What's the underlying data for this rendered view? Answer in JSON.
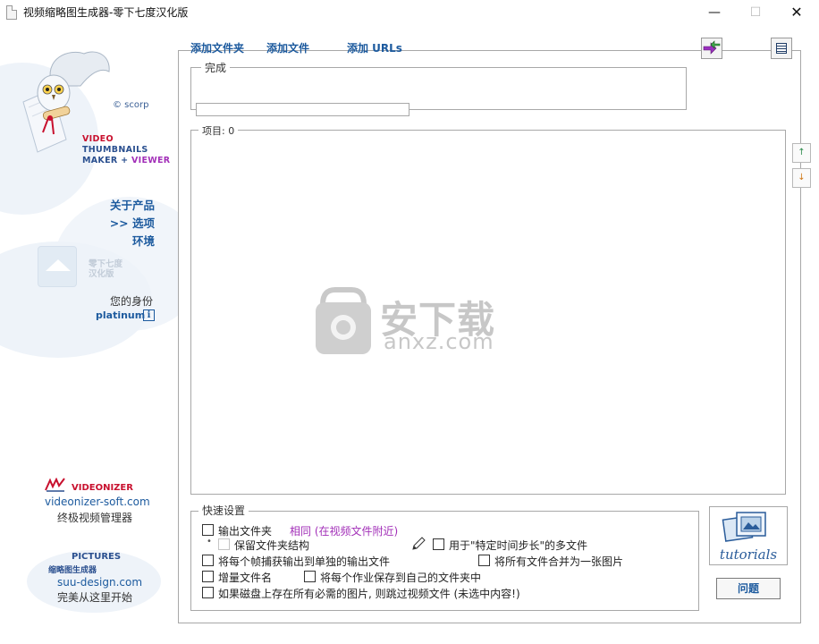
{
  "window": {
    "title": "视频缩略图生成器-零下七度汉化版",
    "minimize_glyph": "—",
    "maximize_glyph": "☐",
    "close_glyph": "✕"
  },
  "sidebar": {
    "copyright": "© scorp",
    "brand": {
      "line1": "VIDEO",
      "line2": "THUMBNAILS",
      "line3_prefix": "MAKER + ",
      "line3_suffix": "VIEWER"
    },
    "nav": {
      "about": "关于产品",
      "options": ">> 选项",
      "environment": "环境"
    },
    "ghost_text": {
      "line1": "零下七度",
      "line2": "汉化版"
    },
    "identity_label": "您的身份",
    "identity_value": "platinum",
    "info_glyph": "i",
    "videonizer": {
      "name": "VIDEONIZER",
      "site": "videonizer-soft.com",
      "desc": "终极视频管理器"
    },
    "pictures": {
      "name": "PICTURES",
      "sub": "缩略图生成器",
      "site": "suu-design.com",
      "desc": "完美从这里开始"
    }
  },
  "toolbar": {
    "add_folder": "添加文件夹",
    "add_file": "添加文件",
    "add_urls": "添加 URLs"
  },
  "status": {
    "done_label": "完成",
    "progress": 0
  },
  "items": {
    "label": "项目: 0",
    "move_up_glyph": "↑",
    "move_down_glyph": "↓"
  },
  "watermark": {
    "text": "安下载",
    "url": "anxz.com"
  },
  "quick_settings": {
    "title": "快速设置",
    "output_folder": {
      "label": "输出文件夹",
      "checked": false
    },
    "same_link": "相同 (在视频文件附近)",
    "keep_structure": {
      "label": "保留文件夹结构",
      "checked": false,
      "disabled": true
    },
    "interval_multi": {
      "label": "用于\"特定时间步长\"的多文件",
      "checked": false
    },
    "separate_files": {
      "label": "将每个帧捕获输出到单独的输出文件",
      "checked": false
    },
    "merge_one": {
      "label": "将所有文件合并为一张图片",
      "checked": false
    },
    "increment_name": {
      "label": "增量文件名",
      "checked": false
    },
    "own_folder": {
      "label": "将每个作业保存到自己的文件夹中",
      "checked": false
    },
    "skip_existing": {
      "label": "如果磁盘上存在所有必需的图片, 则跳过视频文件 (未选中内容!)",
      "checked": false
    }
  },
  "tutorials_label": "tutorials",
  "help_button": "问题",
  "colors": {
    "link_blue": "#1c5a9e",
    "brand_red": "#c8102e",
    "accent_purple": "#a22fb8",
    "frame_gray": "#a8a8a8"
  }
}
